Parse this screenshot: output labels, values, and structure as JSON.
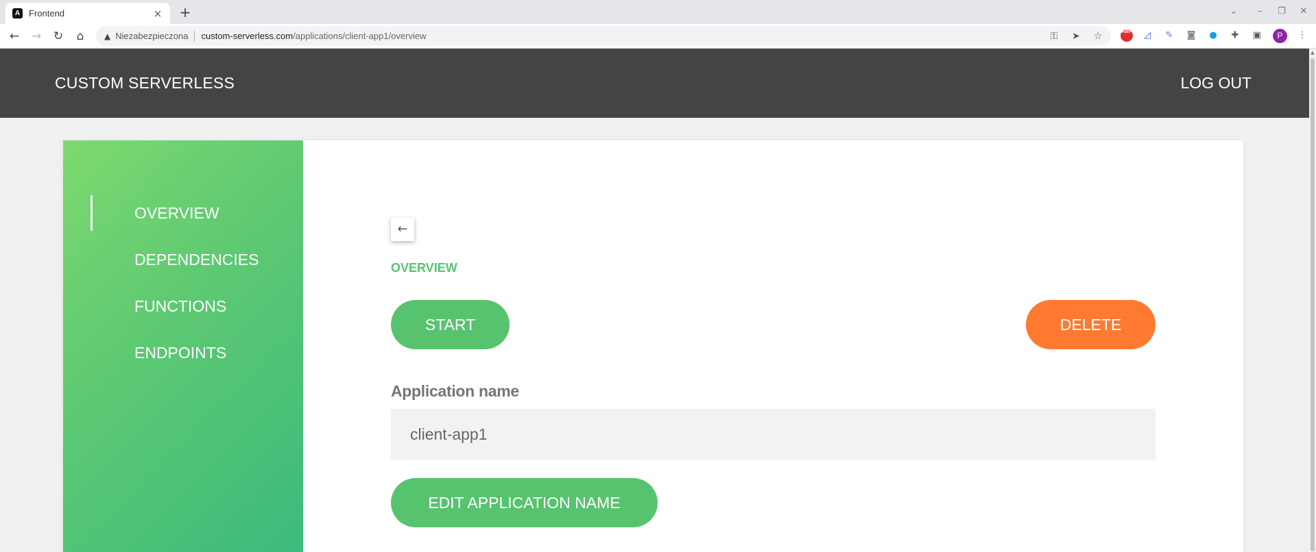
{
  "browser": {
    "tab_title": "Frontend",
    "tab_favicon": "A",
    "tab_close": "×",
    "new_tab": "+",
    "security_label": "Niezabezpieczona",
    "url_host": "custom-serverless.com",
    "url_path": "/applications/client-app1/overview",
    "profile_initial": "P",
    "ext_abp": "ABP"
  },
  "app": {
    "brand": "CUSTOM SERVERLESS",
    "logout": "LOG OUT"
  },
  "sidebar": {
    "items": [
      {
        "label": "OVERVIEW",
        "active": true
      },
      {
        "label": "DEPENDENCIES",
        "active": false
      },
      {
        "label": "FUNCTIONS",
        "active": false
      },
      {
        "label": "ENDPOINTS",
        "active": false
      }
    ]
  },
  "main": {
    "back_icon": "←",
    "section_title": "OVERVIEW",
    "start_label": "START",
    "delete_label": "DELETE",
    "app_name_label": "Application name",
    "app_name_value": "client-app1",
    "edit_label": "EDIT APPLICATION NAME"
  },
  "colors": {
    "accent_green": "#57c36f",
    "danger_orange": "#ff7a30",
    "appbar": "#444444"
  }
}
